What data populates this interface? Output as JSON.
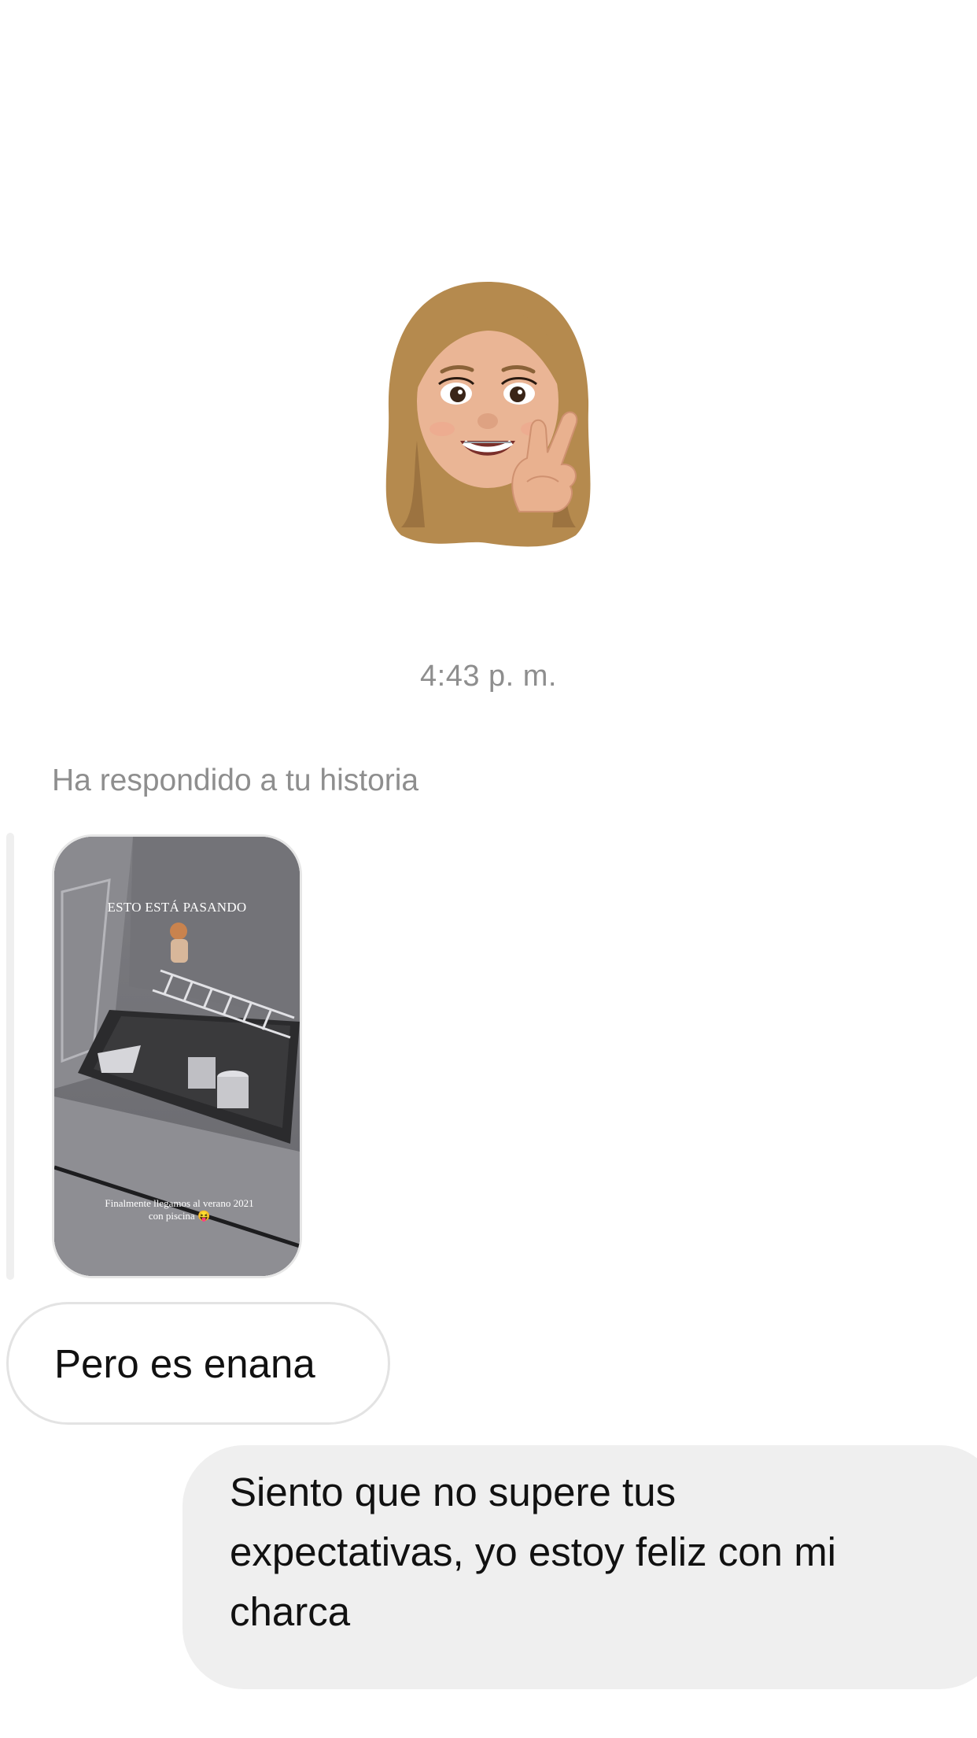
{
  "conversation": {
    "sticker": {
      "icon": "memoji-peace-sign-icon",
      "hair_color": "#b58a4e",
      "skin_color": "#e9b18f"
    },
    "timestamp": "4:43 p. m.",
    "story_reply": {
      "caption": "Ha respondido a tu historia",
      "story_preview": {
        "top_text": "ESTO ESTÁ PASANDO",
        "bottom_text_line1": "Finalmente llegamos al verano 2021",
        "bottom_text_line2": "con piscina 😝"
      }
    },
    "messages": [
      {
        "direction": "received",
        "text": "Pero es enana"
      },
      {
        "direction": "sent",
        "lines": [
          "Siento que no supere tus",
          "expectativas, yo estoy feliz con mi",
          "charca"
        ]
      }
    ]
  },
  "colors": {
    "meta_text": "#8e8e8e",
    "sent_bubble": "#efefef",
    "received_border": "#e3e3e3"
  }
}
